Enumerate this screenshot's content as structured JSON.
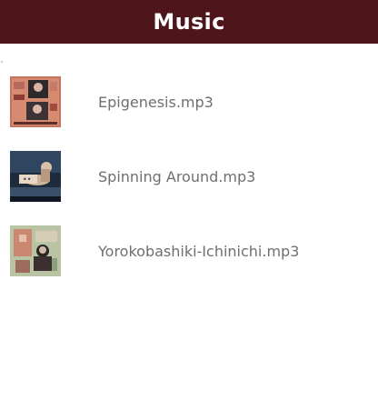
{
  "header": {
    "title": "Music"
  },
  "songs": [
    {
      "file": "Epigenesis.mp3",
      "art_icon": "album-art-epigenesis"
    },
    {
      "file": "Spinning Around.mp3",
      "art_icon": "album-art-spinning-around"
    },
    {
      "file": "Yorokobashiki-Ichinichi.mp3",
      "art_icon": "album-art-yorokobashiki"
    }
  ],
  "colors": {
    "header_bg": "#4e151b",
    "header_text": "#ffffff",
    "item_text": "#6f6f6f",
    "background": "#ffffff"
  }
}
